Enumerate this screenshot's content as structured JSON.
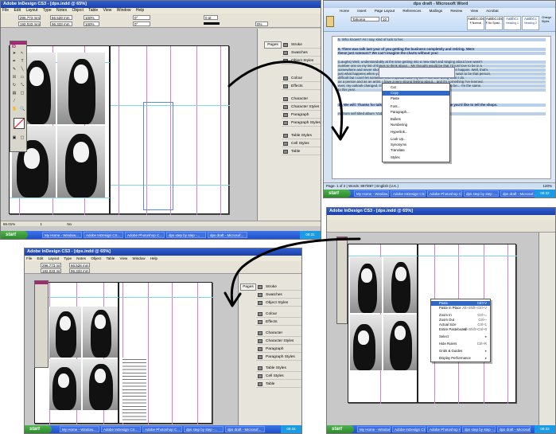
{
  "indesign_top": {
    "title": "Adobe InDesign CS3 - [dps.indd @ 65%]",
    "menu": [
      "File",
      "Edit",
      "Layout",
      "Type",
      "Notes",
      "Object",
      "Table",
      "View",
      "Window",
      "Help"
    ],
    "ctrl": {
      "x1": "296.773 mm",
      "y1": "192.033 mm",
      "w": "66.528 mm",
      "h": "96.333 mm",
      "stroke": "0 pt",
      "zoom": "100%",
      "pct": "0%",
      "rot": "0°"
    },
    "tools_label": "ID",
    "panels": [
      "Pages",
      "Stroke",
      "Swatches",
      "Object Styles",
      "Colour",
      "Effects",
      "Character",
      "Character Styles",
      "Paragraph",
      "Paragraph Styles",
      "Table Styles",
      "Cell Styles",
      "Table"
    ],
    "status": "65.01%",
    "page_num": "1",
    "status_page": "No"
  },
  "taskbar_top": {
    "start": "start",
    "buttons": [
      "My Home - Window...",
      "Adobe InDesign CS...",
      "Adobe Photoshop C...",
      "dps step by step -...",
      "dps draft - Microsof..."
    ],
    "clock": "09:31"
  },
  "word": {
    "title": "dps draft - Microsoft Word",
    "tabs": [
      "Home",
      "Insert",
      "Page Layout",
      "References",
      "Mailings",
      "Review",
      "View",
      "Acrobat"
    ],
    "font": "Tahoma",
    "size": "10",
    "styles": [
      "AaBbCcDc",
      "AaBbCcDc",
      "AaBbCc",
      "AaBbCc"
    ],
    "style_names": [
      "¶ Normal",
      "¶ No Spaci...",
      "Heading 1",
      "Heading 2"
    ],
    "change_styles": "Change Styles",
    "lines": [
      "5. Who knows? As I say, kind of luck to her.",
      "6. There was talk last year of you getting the business completely and retiring. Were",
      "these just rumours? We can't imagine the charts without you!",
      "(Laughs) Well, understandably at the time getting into a new start and singing about love wasn't",
      "number one on my list of things to think about... My thought would be that I'd just love to be in a",
      "somewhere and never show my face again! But I'm happy, and I've never been happier. Well, that's",
      "just what happens when you go through something in public - you know, I just want to be that person.",
      "difficult but I can't let someone else's opinion take my life. I still love doing what I do.",
      "as a person and as an artist. I have a very strong feeling about... and it's something I've learned.",
      "ever, my outlook changed. I'm now in a new happy place and I don't want to be... I'm the same.",
      "to this year.",
      "10. We will: Thanks for talking to us! We'll be back soon. Anything else you'd like to tell the shops.",
      "Authors self titled album 'Vodka' is released on the 25th of June 2010."
    ],
    "context": [
      "Cut",
      "Copy",
      "Paste",
      "Font...",
      "Paragraph...",
      "Bullets",
      "Numbering",
      "Hyperlink...",
      "Look Up...",
      "Synonyms",
      "Translate",
      "Styles"
    ],
    "status": "Page: 1 of 2 | Words: 897/897 | English (U.K.)",
    "zoom": "120%"
  },
  "taskbar_word": {
    "start": "start",
    "buttons": [
      "My Home - Window...",
      "Adobe InDesign CS...",
      "Adobe Photoshop C...",
      "dps step by step -...",
      "dps draft - Microsof..."
    ],
    "clock": "09:32"
  },
  "indesign_right": {
    "title": "Adobe InDesign CS3 - [dps.indd @ 65%]",
    "context": [
      {
        "label": "Paste",
        "sc": "Ctrl+V"
      },
      {
        "label": "Paste in Place",
        "sc": "Alt+Shift+Ctrl+V"
      },
      {
        "label": "Zoom In",
        "sc": "Ctrl+="
      },
      {
        "label": "Zoom Out",
        "sc": "Ctrl+-"
      },
      {
        "label": "Actual Size",
        "sc": "Ctrl+1"
      },
      {
        "label": "Entire Pasteboard",
        "sc": "Alt+Shift+Ctrl+0"
      },
      {
        "label": "Select",
        "sc": ""
      },
      {
        "label": "Hide Rulers",
        "sc": "Ctrl+R"
      },
      {
        "label": "Grids & Guides",
        "sc": ""
      },
      {
        "label": "Display Performance",
        "sc": ""
      }
    ]
  },
  "taskbar_right": {
    "start": "start",
    "buttons": [
      "My Home - Window...",
      "Adobe InDesign CS...",
      "Adobe Photoshop C...",
      "dps step by step -...",
      "dps draft - Microsof..."
    ],
    "clock": "09:33"
  },
  "indesign_bottom": {
    "title": "Adobe InDesign CS3 - [dps.indd @ 65%]",
    "menu": [
      "File",
      "Edit",
      "Layout",
      "Type",
      "Notes",
      "Object",
      "Table",
      "View",
      "Window",
      "Help"
    ],
    "ctrl": {
      "x1": "296.773 mm",
      "y1": "192.033 mm",
      "w": "66.528 mm",
      "h": "96.333 mm"
    },
    "panels": [
      "Pages",
      "Stroke",
      "Swatches",
      "Object Styles",
      "Colour",
      "Effects",
      "Character",
      "Character Styles",
      "Paragraph",
      "Paragraph Styles",
      "Table Styles",
      "Cell Styles",
      "Table"
    ],
    "column_text": "(pasted article text)",
    "status": "65.01%"
  },
  "taskbar_bottom": {
    "start": "start",
    "buttons": [
      "My Home - Window...",
      "Adobe InDesign CS...",
      "Adobe Photoshop C...",
      "dps step by step -...",
      "dps draft - Microsof..."
    ],
    "clock": "09:34"
  },
  "colors": {
    "xp_title": "#1b3fa8",
    "taskbar": "#2456d6",
    "start": "#3aa13a",
    "margin": "#d67ed6",
    "guide": "#7fd6e6",
    "tool_head": "#a32a72",
    "menu_sel": "#316ac5"
  }
}
